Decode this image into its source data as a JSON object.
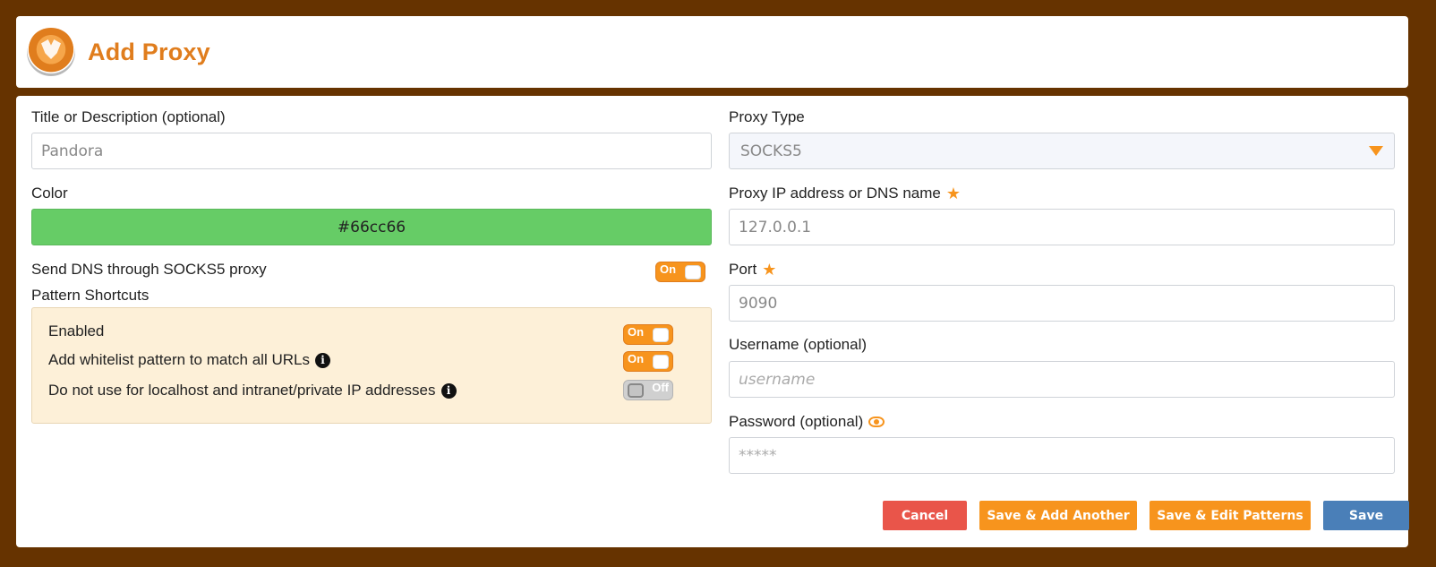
{
  "app": {
    "title": "Add Proxy",
    "logo": "foxyproxy-logo"
  },
  "left": {
    "title_label": "Title or Description (optional)",
    "title_value": "Pandora",
    "color_label": "Color",
    "color_value": "#66cc66",
    "dns_label": "Send DNS through SOCKS5 proxy",
    "dns_toggle": "On",
    "shortcuts_label": "Pattern Shortcuts",
    "shortcuts": [
      {
        "label": "Enabled",
        "toggle": "On",
        "info": false
      },
      {
        "label": "Add whitelist pattern to match all URLs",
        "toggle": "On",
        "info": true
      },
      {
        "label": "Do not use for localhost and intranet/private IP addresses",
        "toggle": "Off",
        "info": true
      }
    ]
  },
  "right": {
    "type_label": "Proxy Type",
    "type_value": "SOCKS5",
    "host_label": "Proxy IP address or DNS name",
    "host_value": "127.0.0.1",
    "port_label": "Port",
    "port_value": "9090",
    "user_label": "Username (optional)",
    "user_placeholder": "username",
    "pass_label": "Password (optional)",
    "pass_placeholder": "*****"
  },
  "buttons": {
    "cancel": "Cancel",
    "save_add": "Save & Add Another",
    "save_edit": "Save & Edit Patterns",
    "save": "Save"
  },
  "colors": {
    "accent": "#f7941d",
    "title": "#e07d1d",
    "cancel": "#e9554a",
    "save": "#4a7fb8",
    "background": "#663300"
  }
}
